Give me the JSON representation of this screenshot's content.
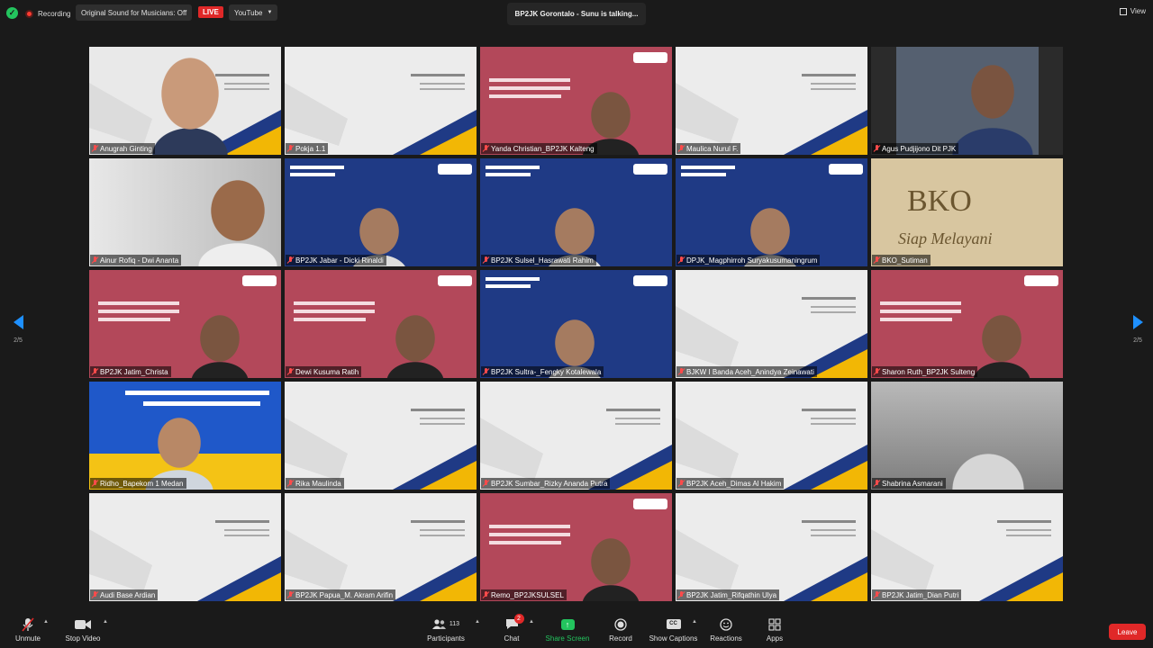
{
  "topbar": {
    "recording_label": "Recording",
    "original_sound_label": "Original Sound for Musicians: Off",
    "live_label": "LIVE",
    "youtube_label": "YouTube",
    "speaker_status": "BP2JK Gorontalo - Sunu is talking...",
    "view_label": "View"
  },
  "pagination": {
    "left": "2/5",
    "right": "2/5"
  },
  "participants": [
    {
      "name": "Anugrah Ginting",
      "bg": "#e9e9e9",
      "kind": "face-white"
    },
    {
      "name": "Pokja 1.1",
      "bg": "#ececec",
      "kind": "white-slide"
    },
    {
      "name": "Yanda Christian_BP2JK Kalteng",
      "bg": "#b3485a",
      "kind": "red-slide"
    },
    {
      "name": "Maulica Nurul F.",
      "bg": "#ececec",
      "kind": "white-slide"
    },
    {
      "name": "Agus Pudjijono Dit PJK",
      "bg": "#2b2b2b",
      "kind": "webcam-dark"
    },
    {
      "name": "Ainur Rofiq - Dwi Ananta",
      "bg": "#cfcfcf",
      "kind": "webcam-light"
    },
    {
      "name": "BP2JK Jabar - Dicki Rinaldi",
      "bg": "#1f3a85",
      "kind": "blue-slide"
    },
    {
      "name": "BP2JK Sulsel_Hasrawati Rahim",
      "bg": "#1f3a85",
      "kind": "blue-slide"
    },
    {
      "name": "DPJK_Magphirroh Suryakusumaningrum",
      "bg": "#1f3a85",
      "kind": "blue-slide"
    },
    {
      "name": "BKO_Sutiman",
      "bg": "#d8c6a0",
      "kind": "bko"
    },
    {
      "name": "BP2JK Jatim_Christa",
      "bg": "#b3485a",
      "kind": "red-slide"
    },
    {
      "name": "Dewi Kusuma Ratih",
      "bg": "#b3485a",
      "kind": "red-slide"
    },
    {
      "name": "BP2JK Sultra-_Fengky Kotalewala",
      "bg": "#1f3a85",
      "kind": "blue-slide"
    },
    {
      "name": "BJKW I Banda Aceh_Anindya Zeinawati",
      "bg": "#ececec",
      "kind": "white-slide"
    },
    {
      "name": "Sharon Ruth_BP2JK Sulteng",
      "bg": "#b3485a",
      "kind": "red-slide"
    },
    {
      "name": "Ridho_Bapekom 1 Medan",
      "bg": "#1f58c9",
      "kind": "balai"
    },
    {
      "name": "Rika Maulinda",
      "bg": "#ececec",
      "kind": "white-slide"
    },
    {
      "name": "BP2JK Sumbar_Rizky Ananda Putra",
      "bg": "#ececec",
      "kind": "white-slide"
    },
    {
      "name": "BP2JK Aceh_Dimas Al Hakim",
      "bg": "#ececec",
      "kind": "white-slide"
    },
    {
      "name": "Shabrina Asmarani",
      "bg": "#9a9a9a",
      "kind": "webcam-gray"
    },
    {
      "name": "Audi Base Ardian",
      "bg": "#ececec",
      "kind": "white-slide"
    },
    {
      "name": "BP2JK Papua_M. Akram Arifin",
      "bg": "#ececec",
      "kind": "white-slide"
    },
    {
      "name": "Remo_BP2JKSULSEL",
      "bg": "#b3485a",
      "kind": "red-slide"
    },
    {
      "name": "BP2JK Jatim_Rifqathin Ulya",
      "bg": "#ececec",
      "kind": "white-slide"
    },
    {
      "name": "BP2JK Jatim_Dian Putri",
      "bg": "#ececec",
      "kind": "white-slide"
    }
  ],
  "toolbar": {
    "unmute": "Unmute",
    "stop_video": "Stop Video",
    "participants": "Participants",
    "participants_count": "113",
    "chat": "Chat",
    "chat_badge": "2",
    "share_screen": "Share Screen",
    "record": "Record",
    "show_captions": "Show Captions",
    "cc_icon": "CC",
    "reactions": "Reactions",
    "apps": "Apps",
    "leave": "Leave"
  },
  "colors": {
    "accent": "#1e90ff",
    "danger": "#e02828",
    "share": "#23c45e"
  }
}
